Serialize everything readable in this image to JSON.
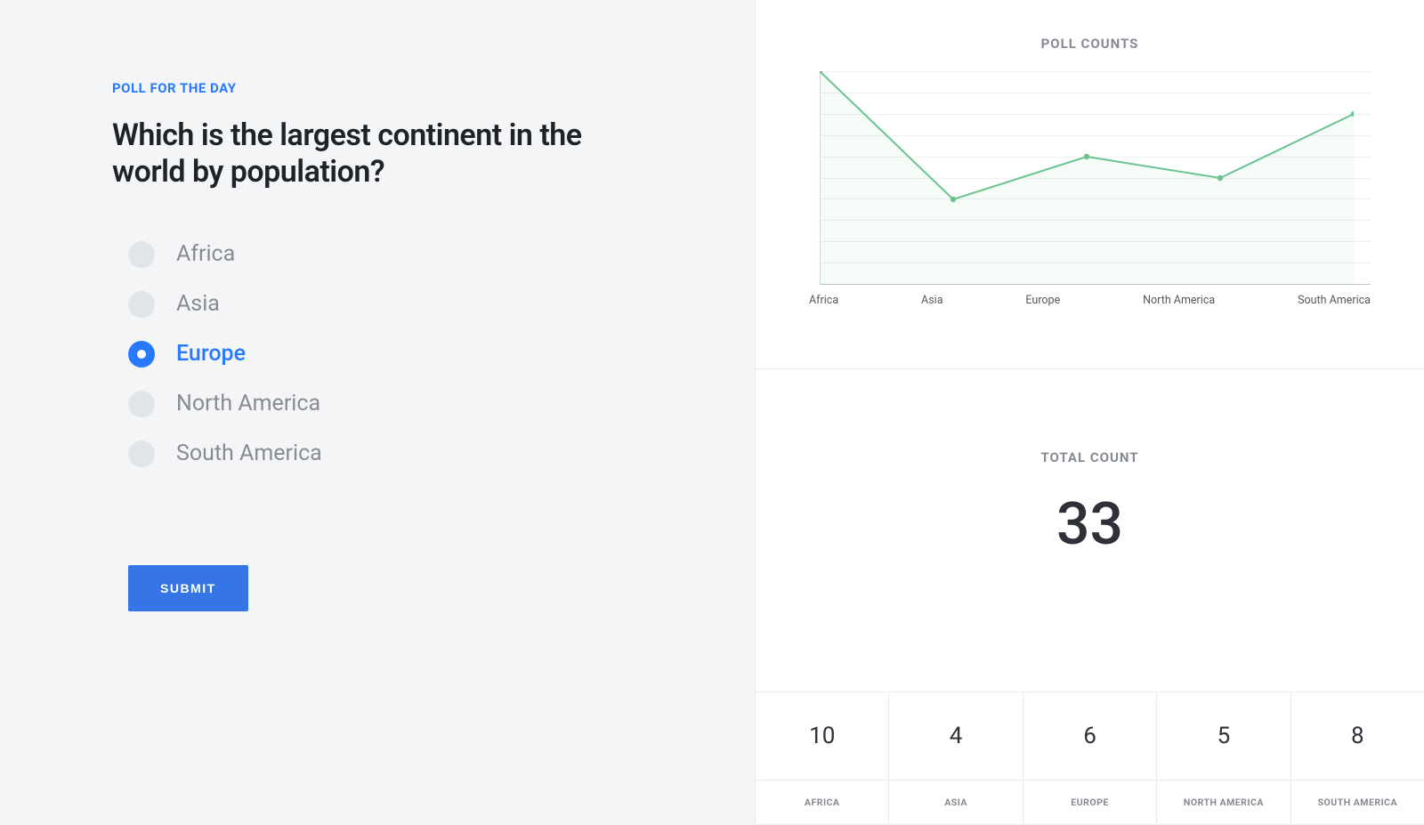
{
  "poll": {
    "eyebrow": "POLL FOR THE DAY",
    "question": "Which is the largest continent in the world by population?",
    "options": [
      {
        "label": "Africa",
        "selected": false
      },
      {
        "label": "Asia",
        "selected": false
      },
      {
        "label": "Europe",
        "selected": true
      },
      {
        "label": "North America",
        "selected": false
      },
      {
        "label": "South America",
        "selected": false
      }
    ],
    "submit_label": "SUBMIT"
  },
  "chart_data": {
    "type": "line",
    "title": "POLL COUNTS",
    "categories": [
      "Africa",
      "Asia",
      "Europe",
      "North America",
      "South America"
    ],
    "values": [
      10,
      4,
      6,
      5,
      8
    ],
    "ylim": [
      0,
      10
    ],
    "color": "#6bc48e"
  },
  "totals": {
    "title": "TOTAL COUNT",
    "total": "33",
    "breakdown": [
      {
        "value": "10",
        "label": "AFRICA"
      },
      {
        "value": "4",
        "label": "ASIA"
      },
      {
        "value": "6",
        "label": "EUROPE"
      },
      {
        "value": "5",
        "label": "NORTH AMERICA"
      },
      {
        "value": "8",
        "label": "SOUTH AMERICA"
      }
    ]
  }
}
